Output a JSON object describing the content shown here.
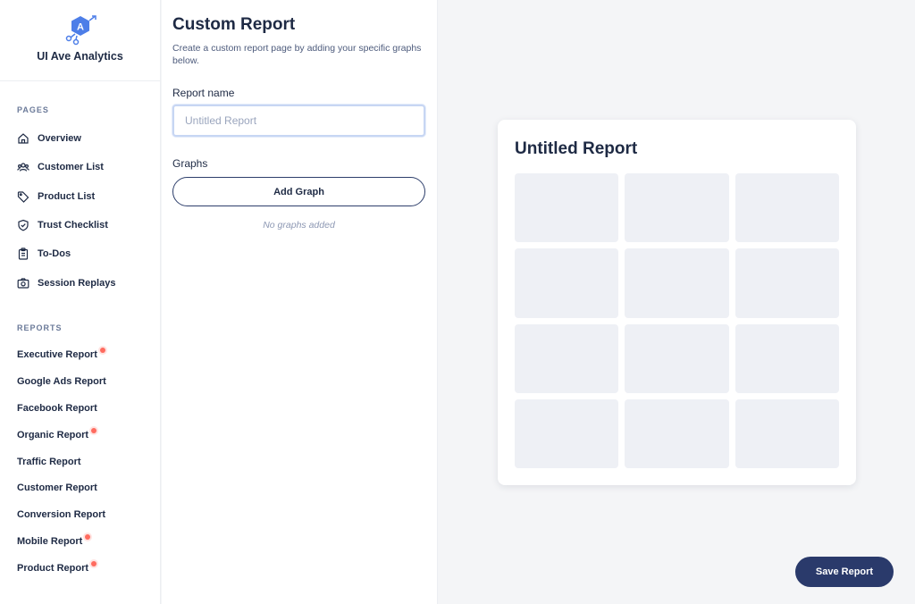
{
  "brand": {
    "name": "UI Ave Analytics",
    "logo_letter": "A"
  },
  "sidebar": {
    "pages_label": "PAGES",
    "pages": [
      {
        "label": "Overview",
        "icon": "home-icon"
      },
      {
        "label": "Customer List",
        "icon": "users-icon"
      },
      {
        "label": "Product List",
        "icon": "tag-icon"
      },
      {
        "label": "Trust Checklist",
        "icon": "shield-icon"
      },
      {
        "label": "To-Dos",
        "icon": "clipboard-icon"
      },
      {
        "label": "Session Replays",
        "icon": "camera-icon"
      }
    ],
    "reports_label": "REPORTS",
    "reports": [
      {
        "label": "Executive Report",
        "badge": true
      },
      {
        "label": "Google Ads Report",
        "badge": false
      },
      {
        "label": "Facebook Report",
        "badge": false
      },
      {
        "label": "Organic Report",
        "badge": true
      },
      {
        "label": "Traffic Report",
        "badge": false
      },
      {
        "label": "Customer Report",
        "badge": false
      },
      {
        "label": "Conversion Report",
        "badge": false
      },
      {
        "label": "Mobile Report",
        "badge": true
      },
      {
        "label": "Product Report",
        "badge": true
      }
    ]
  },
  "form": {
    "title": "Custom Report",
    "description": "Create a custom report page by adding your specific graphs below.",
    "report_name_label": "Report name",
    "report_name_placeholder": "Untitled Report",
    "report_name_value": "",
    "graphs_label": "Graphs",
    "add_graph_label": "Add Graph",
    "empty_note": "No graphs added"
  },
  "preview": {
    "title": "Untitled Report",
    "rows": 4,
    "cols": 3
  },
  "actions": {
    "save_label": "Save Report"
  },
  "colors": {
    "brand_navy": "#2a3a6b",
    "logo_blue": "#4d7ee8",
    "badge_red": "#ff6b5f",
    "placeholder_tile": "#eef0f5"
  }
}
